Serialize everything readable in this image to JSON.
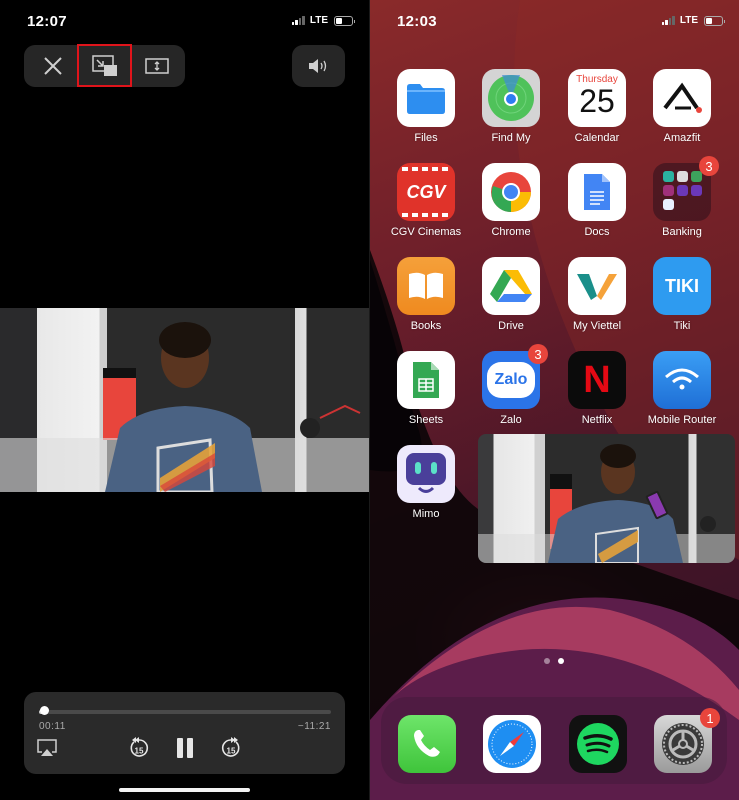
{
  "left_screen": {
    "status_bar": {
      "time": "12:07",
      "network": "LTE"
    },
    "top_controls": {
      "close": "close-icon",
      "pip": "picture-in-picture-icon",
      "aspect": "aspect-fill-icon",
      "volume": "speaker-icon",
      "highlighted": "pip"
    },
    "player": {
      "elapsed": "00:11",
      "remaining": "−11:21",
      "progress_fraction": 0.016,
      "skip_back_label": "15",
      "skip_forward_label": "15",
      "state": "playing"
    }
  },
  "right_screen": {
    "status_bar": {
      "time": "12:03",
      "network": "LTE"
    },
    "apps": [
      {
        "label": "Files",
        "icon": "files-icon"
      },
      {
        "label": "Find My",
        "icon": "find-my-icon"
      },
      {
        "label": "Calendar",
        "icon": "calendar-icon",
        "weekday": "Thursday",
        "day": "25"
      },
      {
        "label": "Amazfit",
        "icon": "amazfit-icon"
      },
      {
        "label": "CGV Cinemas",
        "icon": "cgv-icon",
        "text": "CGV"
      },
      {
        "label": "Chrome",
        "icon": "chrome-icon"
      },
      {
        "label": "Docs",
        "icon": "docs-icon"
      },
      {
        "label": "Banking",
        "icon": "folder-icon",
        "badge": "3"
      },
      {
        "label": "Books",
        "icon": "books-icon"
      },
      {
        "label": "Drive",
        "icon": "drive-icon"
      },
      {
        "label": "My Viettel",
        "icon": "viettel-icon"
      },
      {
        "label": "Tiki",
        "icon": "tiki-icon",
        "text": "TIKI"
      },
      {
        "label": "Sheets",
        "icon": "sheets-icon"
      },
      {
        "label": "Zalo",
        "icon": "zalo-icon",
        "badge": "3",
        "text": "Zalo"
      },
      {
        "label": "Netflix",
        "icon": "netflix-icon",
        "text": "N"
      },
      {
        "label": "Mobile Router",
        "icon": "wifi-router-icon"
      },
      {
        "label": "Mimo",
        "icon": "mimo-icon"
      }
    ],
    "page_dots": {
      "count": 2,
      "active": 1
    },
    "dock": [
      {
        "name": "Phone",
        "icon": "phone-icon"
      },
      {
        "name": "Safari",
        "icon": "safari-icon"
      },
      {
        "name": "Spotify",
        "icon": "spotify-icon"
      },
      {
        "name": "Settings",
        "icon": "settings-icon",
        "badge": "1"
      }
    ]
  }
}
